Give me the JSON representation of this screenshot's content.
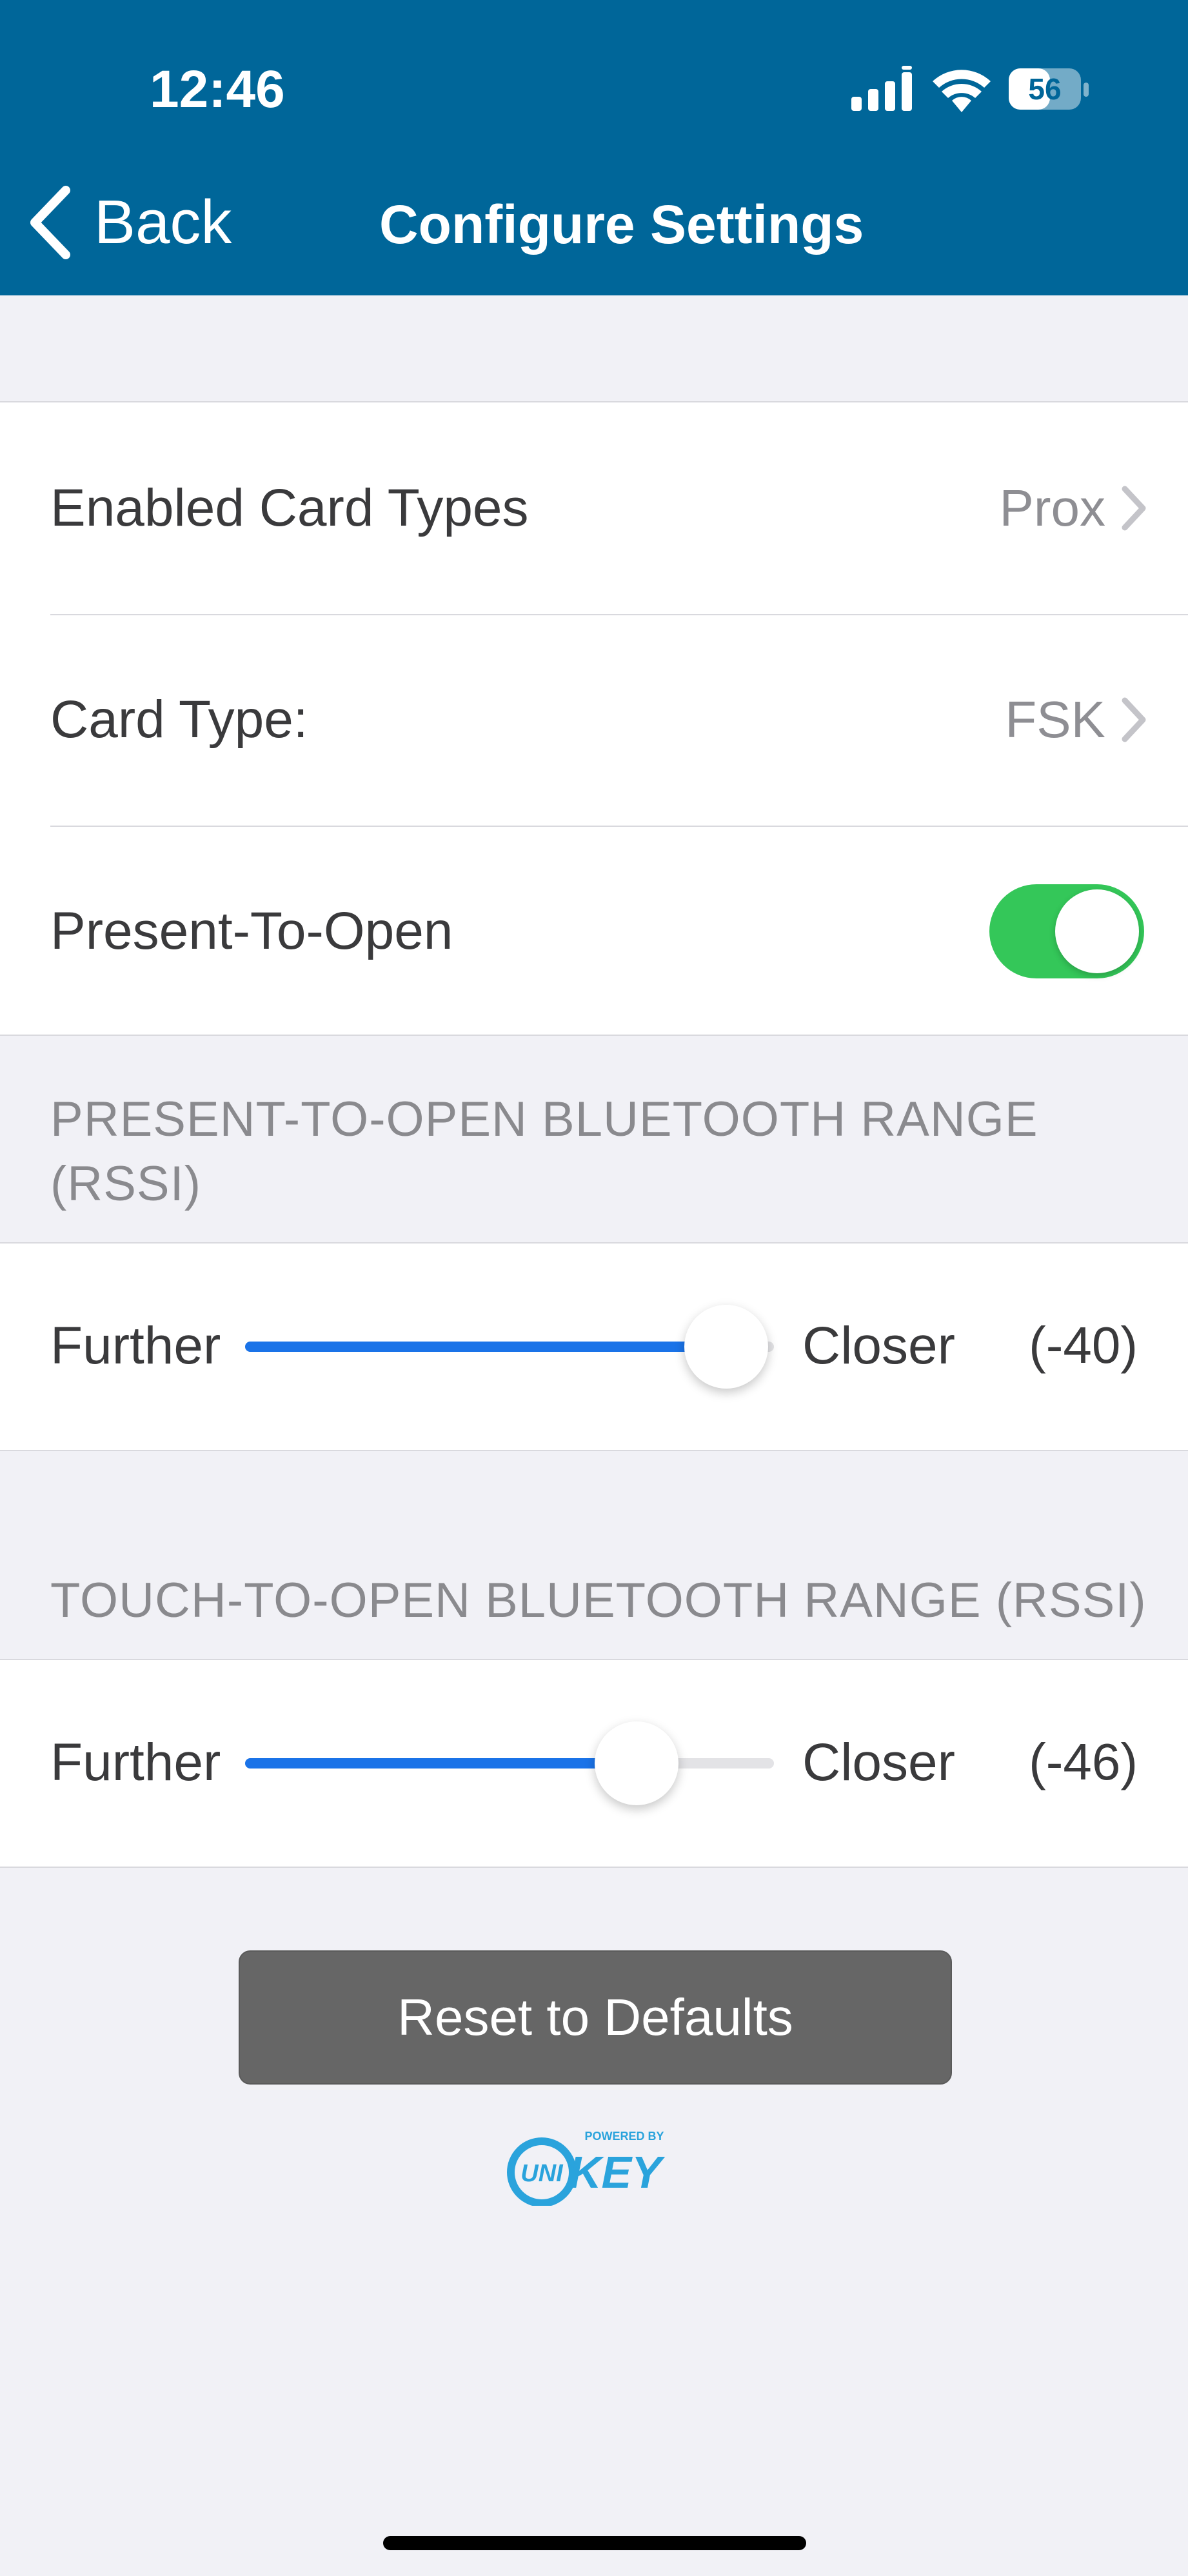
{
  "status_bar": {
    "time": "12:46",
    "battery": "56"
  },
  "nav": {
    "back_label": "Back",
    "title": "Configure Settings"
  },
  "settings": {
    "enabled_card_types": {
      "label": "Enabled Card Types",
      "value": "Prox"
    },
    "card_type": {
      "label": "Card Type:",
      "value": "FSK"
    },
    "present_to_open": {
      "label": "Present-To-Open",
      "enabled": true
    }
  },
  "present_range": {
    "header": "PRESENT-TO-OPEN BLUETOOTH RANGE (RSSI)",
    "left_label": "Further",
    "right_label": "Closer",
    "value_text": "(-40)",
    "fraction": 0.91
  },
  "touch_range": {
    "header": "TOUCH-TO-OPEN BLUETOOTH RANGE (RSSI)",
    "left_label": "Further",
    "right_label": "Closer",
    "value_text": "(-46)",
    "fraction": 0.74
  },
  "reset_button": {
    "label": "Reset to Defaults"
  },
  "logo": {
    "tagline": "POWERED BY",
    "brand_left": "UNI",
    "brand_right": "KEY"
  },
  "colors": {
    "header": "#006699",
    "toggle_on": "#34c759",
    "slider_fill": "#1a73e8",
    "button": "#666666"
  }
}
